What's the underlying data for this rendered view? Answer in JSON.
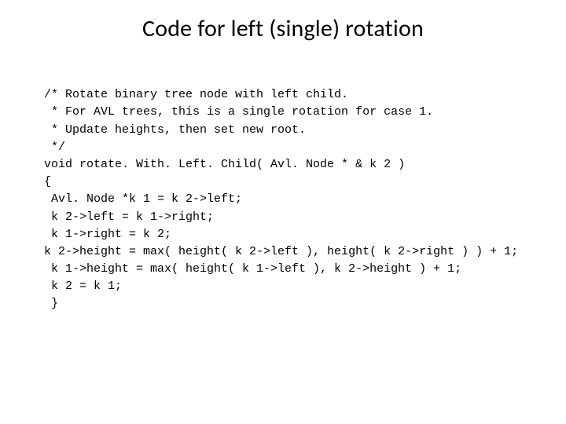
{
  "title": "Code for left (single) rotation",
  "code": {
    "l01": "/* Rotate binary tree node with left child.",
    "l02": " * For AVL trees, this is a single rotation for case 1.",
    "l03": " * Update heights, then set new root.",
    "l04": " */",
    "l05": "void rotate. With. Left. Child( Avl. Node * & k 2 )",
    "l06": "{",
    "l07": " Avl. Node *k 1 = k 2->left;",
    "l08": " k 2->left = k 1->right;",
    "l09": " k 1->right = k 2;",
    "l10": "k 2->height = max( height( k 2->left ), height( k 2->right ) ) + 1;",
    "l11": " k 1->height = max( height( k 1->left ), k 2->height ) + 1;",
    "l12": " k 2 = k 1;",
    "l13": " }"
  }
}
